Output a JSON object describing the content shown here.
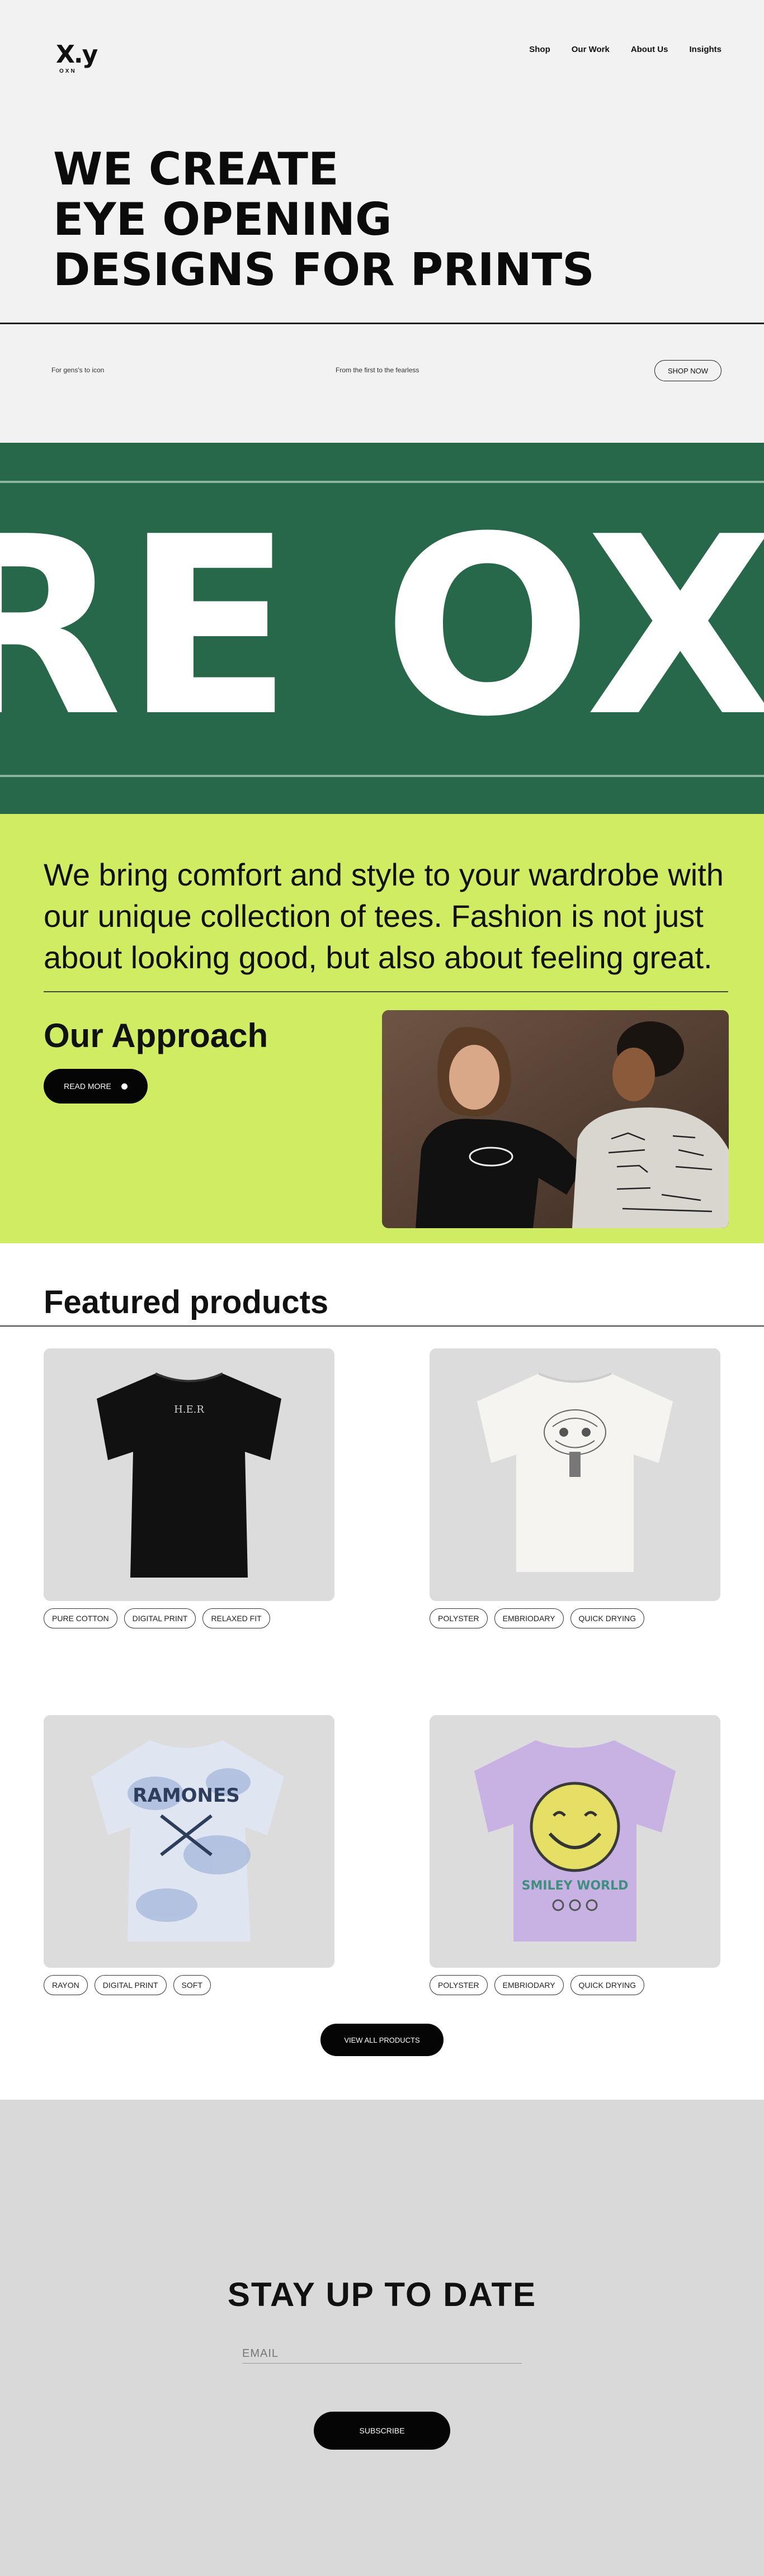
{
  "brand": {
    "logo_mark": "X.y",
    "logo_sub": "OXN"
  },
  "nav": {
    "items": [
      "Shop",
      "Our Work",
      "About Us",
      "Insights"
    ]
  },
  "hero": {
    "headline_lines": [
      "WE CREATE",
      "EYE OPENING",
      "DESIGNS FOR PRINTS"
    ],
    "tagline_left": "For gens's to icon",
    "tagline_center": "From the first to the fearless",
    "shop_now": "SHOP NOW"
  },
  "marquee": {
    "text": "RE OXY"
  },
  "about": {
    "statement": "We bring comfort and style to your wardrobe with our unique collection of tees. Fashion is not just about looking good, but also about feeling great.",
    "approach_title": "Our Approach",
    "read_more": "READ MORE"
  },
  "featured": {
    "title": "Featured products",
    "products": [
      {
        "tags": [
          "PURE COTTON",
          "DIGITAL PRINT",
          "RELAXED FIT"
        ],
        "print": "H.E.R"
      },
      {
        "tags": [
          "POLYSTER",
          "EMBRIODARY",
          "QUICK DRYING"
        ]
      },
      {
        "tags": [
          "RAYON",
          "DIGITAL PRINT",
          "SOFT"
        ],
        "print": "RAMONES"
      },
      {
        "tags": [
          "POLYSTER",
          "EMBRIODARY",
          "QUICK DRYING"
        ],
        "print": "SMILEY WORLD"
      }
    ],
    "view_all": "VIEW ALL PRODUCTS"
  },
  "subscribe": {
    "title": "STAY UP TO DATE",
    "email_placeholder": "EMAIL",
    "button": "SUBSCRIBE"
  },
  "colors": {
    "hero_bg": "#f2f2f2",
    "marquee_bg": "#266849",
    "lime_bg": "#cfec63",
    "subscribe_bg": "#d9d9d9",
    "button_bg": "#050505"
  }
}
